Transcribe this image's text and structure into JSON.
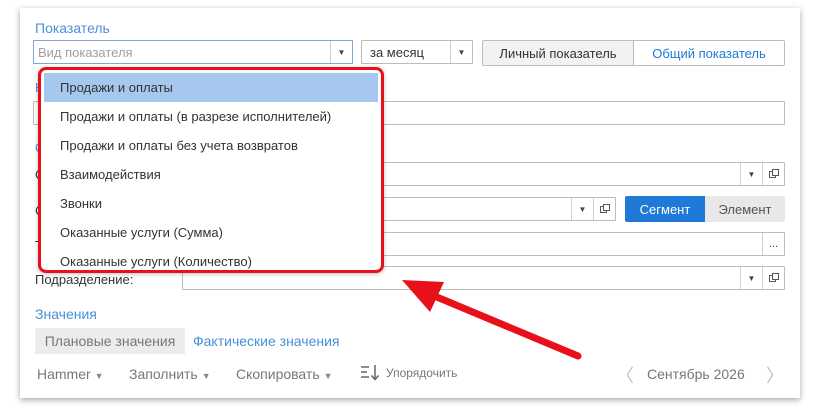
{
  "indicator": {
    "section_title": "Показатель",
    "type_placeholder": "Вид показателя",
    "period_value": "за месяц",
    "scope_personal": "Личный показатель",
    "scope_general": "Общий показатель"
  },
  "dropdown": {
    "items": [
      "Продажи и оплаты",
      "Продажи и оплаты (в разрезе исполнителей)",
      "Продажи и оплаты без учета возвратов",
      "Взаимодействия",
      "Звонки",
      "Оказанные услуги (Сумма)",
      "Оказанные услуги (Количество)"
    ],
    "selected_index": 0
  },
  "partial_labels": {
    "h": "Н",
    "s1": "С",
    "s2": "С",
    "s3": "С",
    "t": "Т"
  },
  "filters": {
    "segment_label": "Сегмент",
    "element_label": "Элемент",
    "more_label": "...",
    "department_label": "Подразделение:"
  },
  "values": {
    "section_title": "Значения",
    "tab_planned": "Плановые значения",
    "tab_actual": "Фактические значения"
  },
  "toolbar": {
    "hammer": "Hammer",
    "fill": "Заполнить",
    "copy": "Скопировать",
    "sort": "Упорядочить",
    "period": "Сентябрь 2026"
  },
  "colors": {
    "accent": "#4a90d9",
    "segment_active": "#1e7ad6",
    "highlight": "#e8101a",
    "selected_row": "#a6c8ee"
  }
}
